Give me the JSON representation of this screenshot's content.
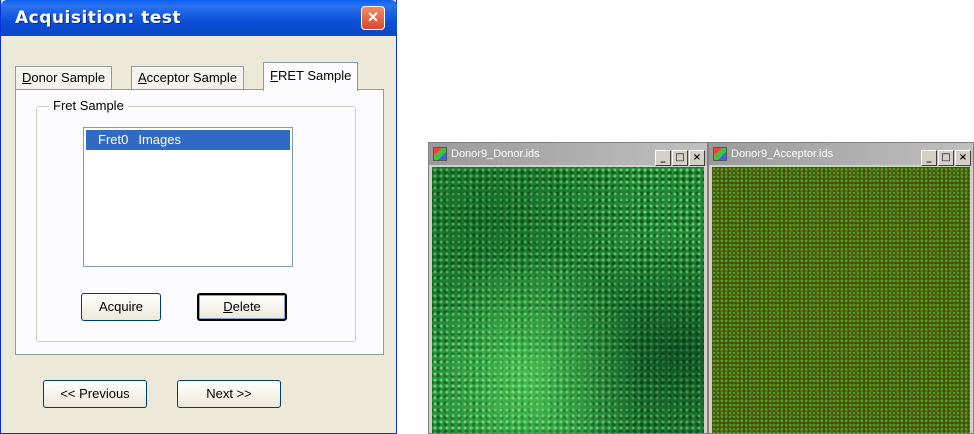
{
  "dialog": {
    "title": "Acquisition:  test",
    "close_glyph": "×",
    "tabs": [
      {
        "label_pre": "",
        "label_ul": "D",
        "label_post": "onor Sample",
        "active": false
      },
      {
        "label_pre": "",
        "label_ul": "A",
        "label_post": "cceptor Sample",
        "active": false
      },
      {
        "label_pre": "",
        "label_ul": "F",
        "label_post": "RET Sample",
        "active": true
      }
    ],
    "group_label": "Fret Sample",
    "list_items": [
      {
        "name": "Fret0",
        "type": "Images",
        "selected": true
      }
    ],
    "acquire_label": "Acquire",
    "delete_ul": "D",
    "delete_rest": "elete",
    "previous_label": "<< Previous",
    "next_label": "Next >>"
  },
  "windows": [
    {
      "title": "Donor9_Donor.ids",
      "min": "_",
      "max": "□",
      "close": "×",
      "color": "#2aa040"
    },
    {
      "title": "Donor9_Acceptor.ids",
      "min": "_",
      "max": "□",
      "close": "×",
      "color": "#4a4a0e"
    }
  ]
}
